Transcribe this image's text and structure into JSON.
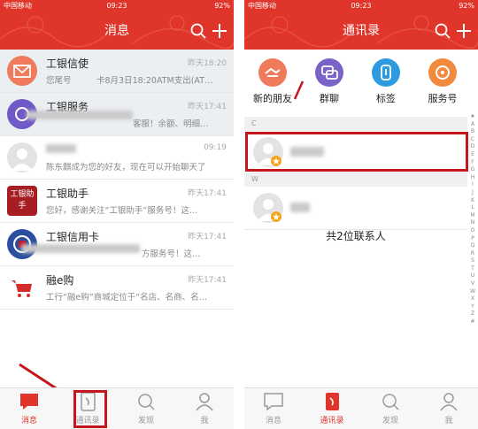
{
  "status_bar": {
    "carrier": "中国移动",
    "time": "09:23",
    "battery": "92%"
  },
  "colors": {
    "brand_red": "#e0352a",
    "annotation_red": "#c4161c",
    "tab_inactive": "#999999"
  },
  "left_screen": {
    "title": "消息",
    "header_icons": [
      "search-icon",
      "plus-icon"
    ],
    "messages": [
      {
        "name": "工银信使",
        "time": "昨天18:20",
        "preview": "您尾号　　　卡8月3日18:20ATM支出(AT…",
        "avatar_icon": "envelope-icon"
      },
      {
        "name": "工银服务",
        "time": "昨天17:41",
        "preview": "客服！余额、明细…",
        "avatar_icon": "service-icon"
      },
      {
        "name": "",
        "time": "09:19",
        "preview": "陈东麒成为您的好友，现在可以开始聊天了",
        "avatar_icon": "default-avatar-icon"
      },
      {
        "name": "工银助手",
        "time": "昨天17:41",
        "preview": "您好，感谢关注“工银助手”服务号！这…",
        "avatar_icon": "icbc-assistant-logo",
        "avatar_text": "工银助手"
      },
      {
        "name": "工银信用卡",
        "time": "昨天17:41",
        "preview": "方服务号！这…",
        "avatar_icon": "icbc-card-logo"
      },
      {
        "name": "融e购",
        "time": "昨天17:41",
        "preview": "工行“融e购”商城定位于“名店、名商、名…",
        "avatar_icon": "cart-icon"
      }
    ],
    "tabs": [
      {
        "label": "消息",
        "icon": "chat-bubble-icon",
        "active": true
      },
      {
        "label": "通讯录",
        "icon": "contacts-book-icon",
        "active": false
      },
      {
        "label": "发现",
        "icon": "discover-search-icon",
        "active": false
      },
      {
        "label": "我",
        "icon": "person-icon",
        "active": false
      }
    ]
  },
  "right_screen": {
    "title": "通讯录",
    "header_icons": [
      "search-icon",
      "plus-icon"
    ],
    "quick_links": [
      {
        "label": "新的朋友",
        "icon": "handshake-icon",
        "color": "#f07a5c"
      },
      {
        "label": "群聊",
        "icon": "group-chat-icon",
        "color": "#7b62c9"
      },
      {
        "label": "标签",
        "icon": "tag-icon",
        "color": "#2e9be0"
      },
      {
        "label": "服务号",
        "icon": "service-icon",
        "color": "#f28a3d"
      }
    ],
    "sections": [
      {
        "letter": "C",
        "contacts": [
          {
            "name": "陈东麒"
          }
        ]
      },
      {
        "letter": "W",
        "contacts": [
          {
            "name": ""
          }
        ]
      }
    ],
    "contact_count_text": "共2位联系人",
    "index_letters": [
      "★",
      "A",
      "B",
      "C",
      "D",
      "E",
      "F",
      "G",
      "H",
      "I",
      "J",
      "K",
      "L",
      "M",
      "N",
      "O",
      "P",
      "Q",
      "R",
      "S",
      "T",
      "U",
      "V",
      "W",
      "X",
      "Y",
      "Z",
      "#"
    ],
    "tabs": [
      {
        "label": "消息",
        "icon": "chat-bubble-icon",
        "active": false
      },
      {
        "label": "通讯录",
        "icon": "contacts-book-icon",
        "active": true
      },
      {
        "label": "发现",
        "icon": "discover-search-icon",
        "active": false
      },
      {
        "label": "我",
        "icon": "person-icon",
        "active": false
      }
    ]
  }
}
